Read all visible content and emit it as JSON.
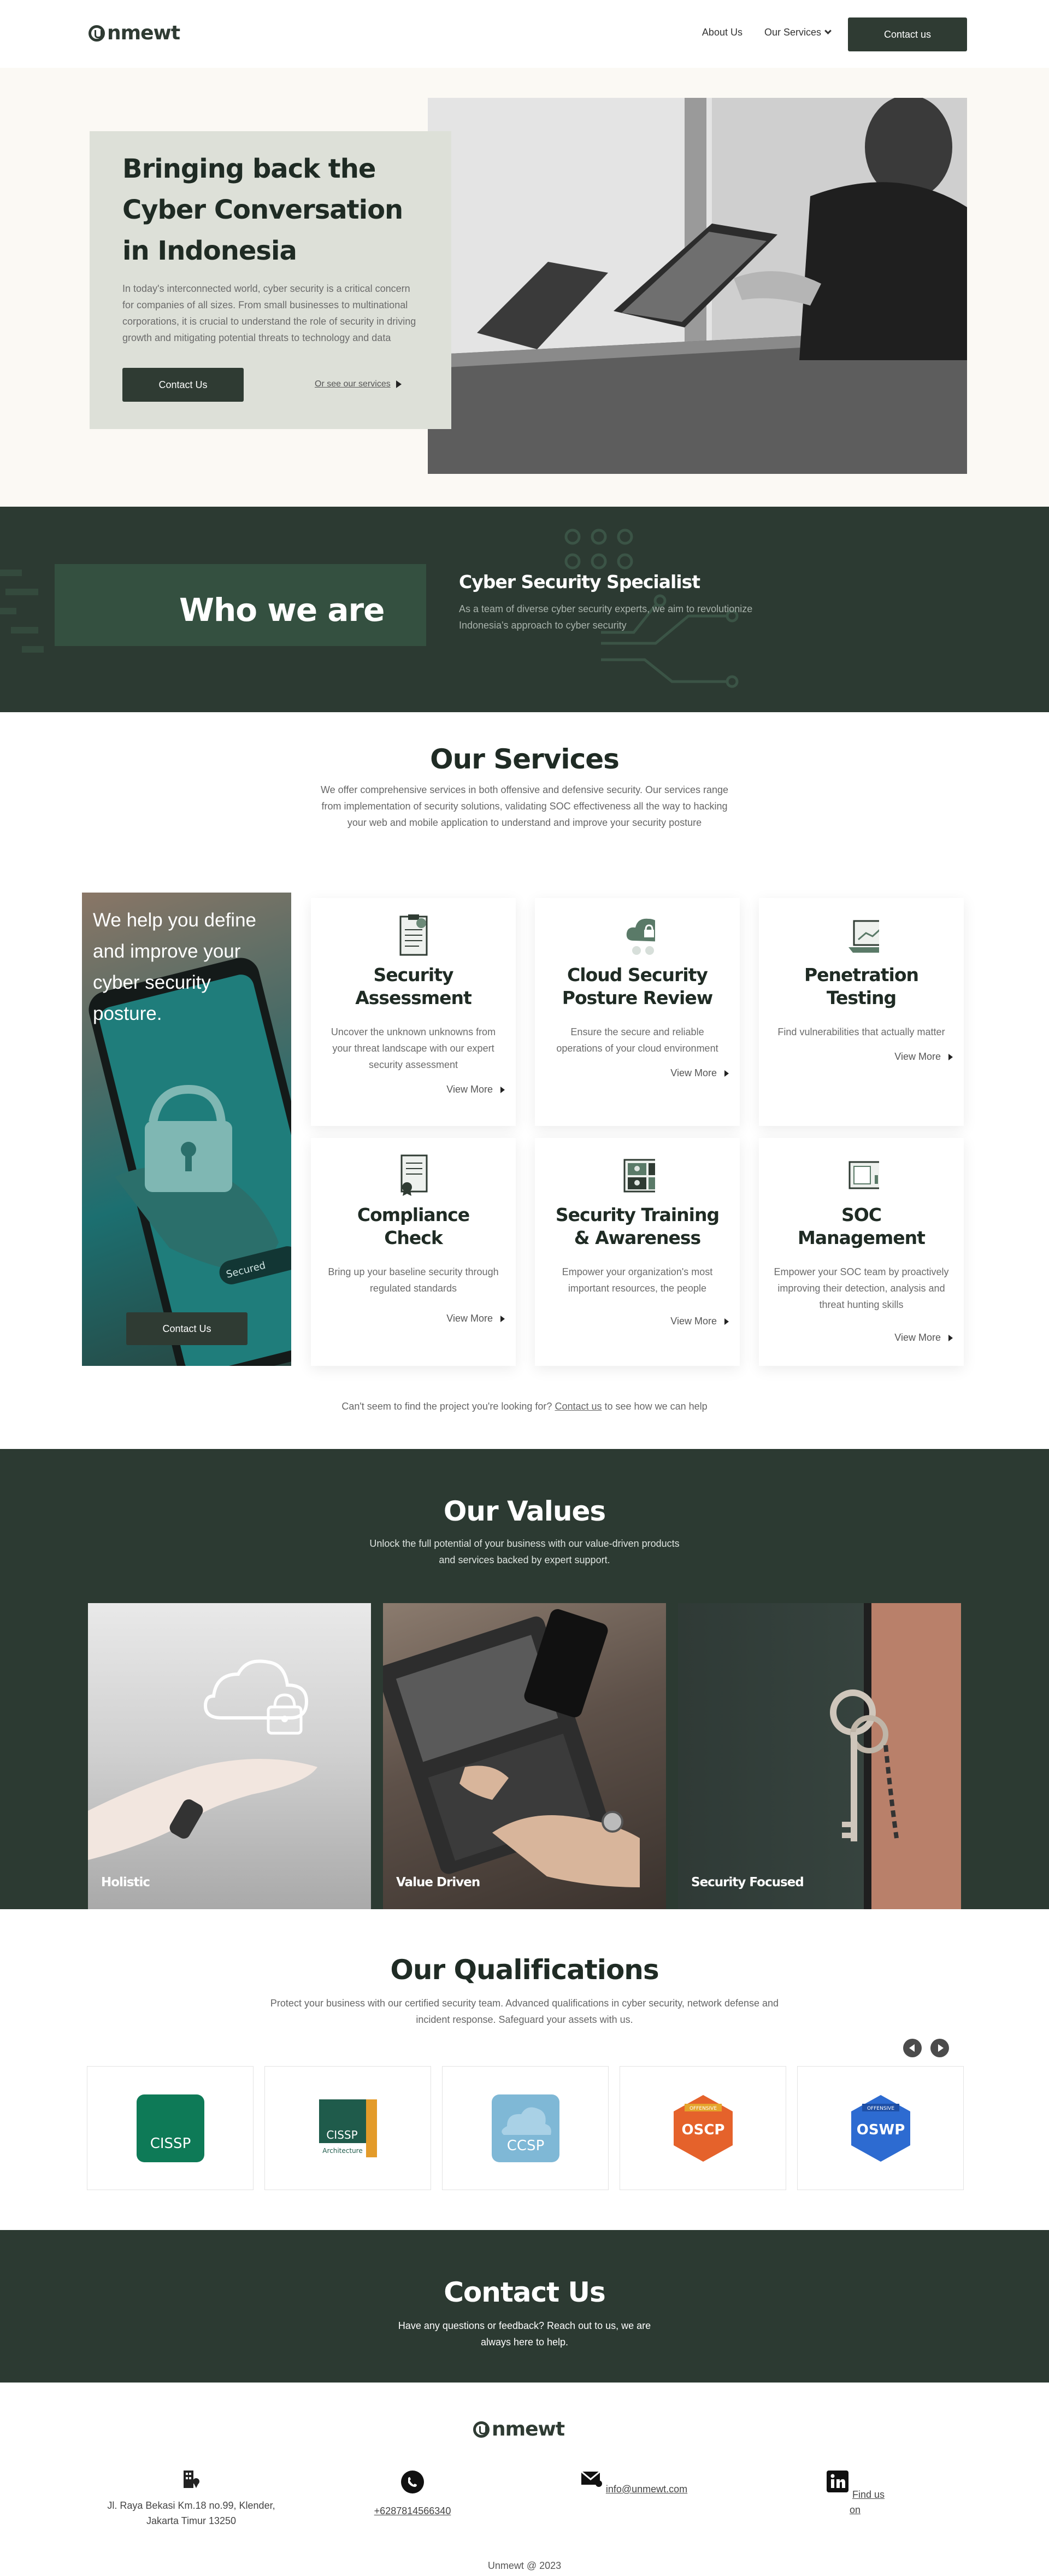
{
  "nav": {
    "brand": "nmewt",
    "about": "About Us",
    "services": "Our Services",
    "contact_cta": "Contact us"
  },
  "hero": {
    "title": "Bringing back the Cyber Conversation in Indonesia",
    "description": "In today's interconnected world, cyber security is a critical concern for companies of all sizes. From small businesses to multinational corporations, it is crucial to understand the role of security in driving growth and mitigating potential threats to technology and data",
    "cta": "Contact Us",
    "link": "Or see our services"
  },
  "who": {
    "title": "Who we are",
    "subtitle": "Cyber Security Specialist",
    "description": "As a team of diverse cyber security experts, we aim to revolutionize Indonesia's approach to cyber security"
  },
  "services": {
    "title": "Our Services",
    "description": "We offer comprehensive services in both offensive and defensive security. Our services range from implementation of security solutions, validating SOC effectiveness all the way to hacking your web and mobile application to understand and improve your security posture",
    "promo_text": "We help you define and improve your cyber security posture.",
    "promo_cta": "Contact Us",
    "phone_label": "Secured",
    "more_label": "View More",
    "items": [
      {
        "name": "Security Assessment",
        "desc": "Uncover the unknown unknowns from your threat landscape with our expert security assessment"
      },
      {
        "name": "Cloud Security Posture Review",
        "desc": "Ensure the secure and reliable operations of your cloud environment"
      },
      {
        "name": "Penetration Testing",
        "desc": "Find vulnerabilities that actually matter"
      },
      {
        "name": "Compliance Check",
        "desc": "Bring up your baseline security through regulated standards"
      },
      {
        "name": "Security Training & Awareness",
        "desc": "Empower your organization's most important resources, the people"
      },
      {
        "name": "SOC Management",
        "desc": "Empower your SOC team by proactively improving their detection, analysis and threat hunting skills"
      }
    ],
    "looking_prefix": "Can't seem to find the project you're looking for?",
    "looking_link": "Contact us",
    "looking_suffix": "to see how we can help"
  },
  "values": {
    "title": "Our Values",
    "description": "Unlock the full potential of your business with our value-driven products and services backed by expert support.",
    "items": [
      "Holistic",
      "Value Driven",
      "Security Focused"
    ]
  },
  "qualifications": {
    "title": "Our Qualifications",
    "description": "Protect your business with our certified security team. Advanced qualifications in cyber security, network defense and incident response. Safeguard your assets with us.",
    "certs": [
      {
        "name": "CISSP",
        "color": "#0e7a57"
      },
      {
        "name": "CISSP",
        "sub": "Architecture",
        "color": "#1f5b4b",
        "accent": "#e39b2a"
      },
      {
        "name": "CCSP",
        "color": "#7fb8d6"
      },
      {
        "name": "OSCP",
        "top": "OFFENSIVE",
        "color": "#e5622b"
      },
      {
        "name": "OSWP",
        "top": "OFFENSIVE",
        "color": "#2d6bd1"
      }
    ]
  },
  "contact": {
    "title": "Contact Us",
    "description": "Have any questions or feedback? Reach out to us, we are always here to help."
  },
  "footer": {
    "brand": "nmewt",
    "address": "Jl. Raya Bekasi Km.18 no.99, Klender, Jakarta Timur 13250",
    "phone": "+6287814566340",
    "email": "info@unmewt.com",
    "linkedin": "Find us on",
    "copyright": "Unmewt @ 2023"
  },
  "colors": {
    "primary_dark": "#2c3a32",
    "hero_bg": "#fbf9f4",
    "hero_card": "#dde0d8"
  }
}
